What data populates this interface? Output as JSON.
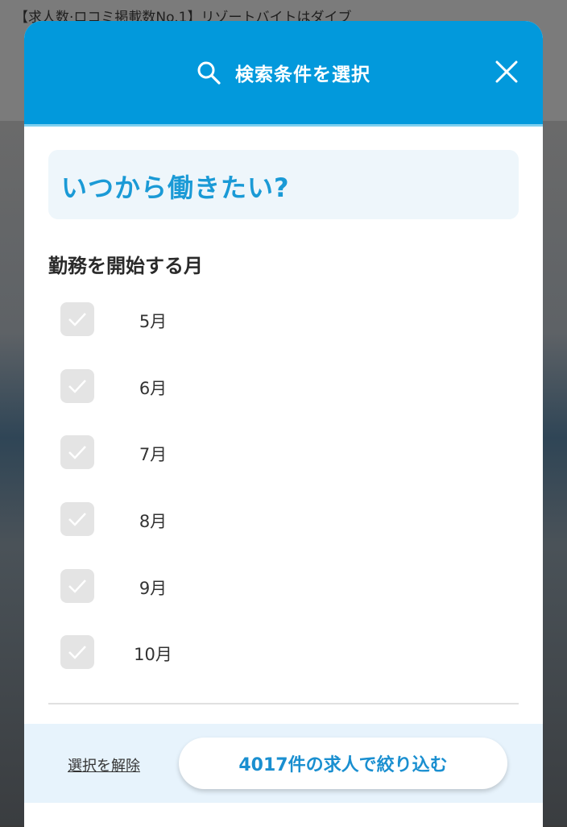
{
  "background": {
    "page_title": "【求人数·ロコミ掲載数No.1】リゾートバイトはダイブ"
  },
  "modal": {
    "header_title": "検索条件を選択",
    "search_icon": "search-icon",
    "close_icon": "close-icon",
    "question": "いつから働きたい?",
    "section_label": "勤務を開始する月",
    "months": [
      {
        "label": "5月",
        "checked": false
      },
      {
        "label": "6月",
        "checked": false
      },
      {
        "label": "7月",
        "checked": false
      },
      {
        "label": "8月",
        "checked": false
      },
      {
        "label": "9月",
        "checked": false
      },
      {
        "label": "10月",
        "checked": false
      }
    ],
    "footer": {
      "clear_label": "選択を解除",
      "submit_label": "4017件の求人で絞り込む"
    }
  },
  "colors": {
    "header_blue": "#0299dc",
    "accent_text": "#1a9ad6",
    "footer_bg": "#e7f3fc",
    "checkbox_bg": "#e4e4e4"
  }
}
